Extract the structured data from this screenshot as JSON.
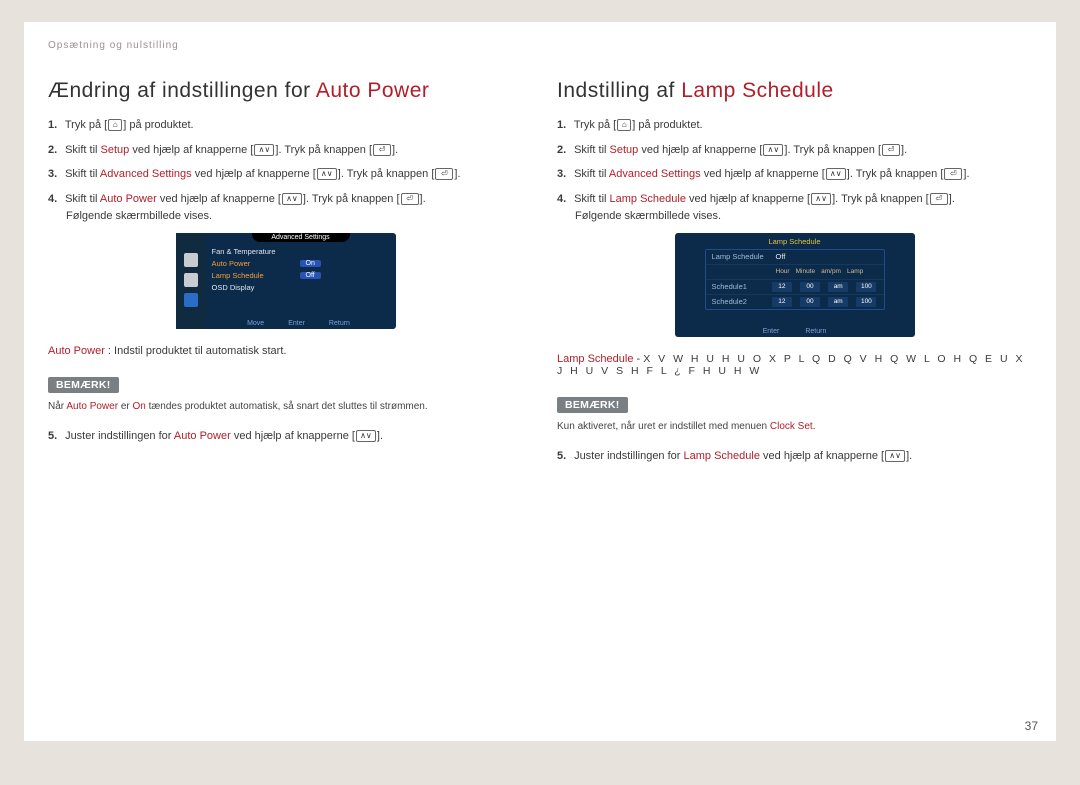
{
  "breadcrumb": "Opsætning og nulstilling",
  "pageNumber": "37",
  "noteLabel": "BEMÆRK!",
  "icons": {
    "home": "⌂",
    "updown": "∧∨",
    "enter": "⏎"
  },
  "left": {
    "titlePlain": "Ændring af indstillingen for ",
    "titleAccent": "Auto Power",
    "steps": {
      "s1": {
        "n": "1.",
        "a": "Tryk på [",
        "b": "] på produktet."
      },
      "s2": {
        "n": "2.",
        "a": "Skift til ",
        "hl": "Setup",
        "b": " ved hjælp af knapperne [",
        "c": "]. Tryk på knappen [",
        "d": "]."
      },
      "s3": {
        "n": "3.",
        "a": "Skift til ",
        "hl": "Advanced Settings",
        "b": " ved hjælp af knapperne [",
        "c": "]. Tryk på knappen [",
        "d": "]."
      },
      "s4": {
        "n": "4.",
        "a": "Skift til ",
        "hl": "Auto Power",
        "b": " ved hjælp af knapperne [",
        "c": "]. Tryk på knappen [",
        "d": "].",
        "sub": "Følgende skærmbillede vises."
      },
      "s5": {
        "n": "5.",
        "a": "Juster indstillingen for ",
        "hl": "Auto Power",
        "b": " ved hjælp af knapperne [",
        "c": "]."
      }
    },
    "osd": {
      "header": "Advanced Settings",
      "rows": {
        "r1": "Fan & Temperature",
        "r2": "Auto Power",
        "r2val": "On",
        "r3": "Lamp Schedule",
        "r3val": "Off",
        "r4": "OSD Display"
      },
      "foot": {
        "a": "Move",
        "b": "Enter",
        "c": "Return"
      }
    },
    "desc": {
      "hl": "Auto Power",
      "sep": " : ",
      "txt": "Indstil produktet til automatisk start."
    },
    "note": {
      "a": "Når ",
      "hl1": "Auto Power",
      "b": " er ",
      "hl2": "On",
      "c": " tændes produktet automatisk, så snart det sluttes til strømmen."
    }
  },
  "right": {
    "titlePlain": "Indstilling af ",
    "titleAccent": "Lamp Schedule",
    "steps": {
      "s1": {
        "n": "1.",
        "a": "Tryk på [",
        "b": "] på produktet."
      },
      "s2": {
        "n": "2.",
        "a": "Skift til ",
        "hl": "Setup",
        "b": " ved hjælp af knapperne [",
        "c": "]. Tryk på knappen [",
        "d": "]."
      },
      "s3": {
        "n": "3.",
        "a": "Skift til ",
        "hl": "Advanced Settings",
        "b": " ved hjælp af knapperne [",
        "c": "]. Tryk på knappen [",
        "d": "]."
      },
      "s4": {
        "n": "4.",
        "a": "Skift til ",
        "hl": "Lamp Schedule",
        "b": " ved hjælp af knapperne [",
        "c": "]. Tryk på knappen [",
        "d": "].",
        "sub": "Følgende skærmbillede vises."
      },
      "s5": {
        "n": "5.",
        "a": "Juster indstillingen for ",
        "hl": "Lamp Schedule",
        "b": " ved hjælp af knapperne [",
        "c": "]."
      }
    },
    "osd": {
      "header": "Lamp Schedule",
      "row1": {
        "lab": "Lamp Schedule",
        "val": "Off"
      },
      "cols": {
        "c1": "Hour",
        "c2": "Minute",
        "c3": "am/pm",
        "c4": "Lamp"
      },
      "rowA": {
        "lab": "Schedule1",
        "v1": "12",
        "v2": "00",
        "v3": "am",
        "v4": "100"
      },
      "rowB": {
        "lab": "Schedule2",
        "v1": "12",
        "v2": "00",
        "v3": "am",
        "v4": "100"
      },
      "foot": {
        "a": "Enter",
        "b": "Return"
      }
    },
    "desc": {
      "hl": "Lamp Schedule",
      "sep": "   - ",
      "garbled": "X V W H U H U   O X P L Q D Q V H Q   W L O   H Q   E U X J H U V S H F L ¿ F H U H W"
    },
    "note": {
      "a": "Kun aktiveret, når uret er indstillet med menuen ",
      "hl": "Clock Set",
      "b": "."
    }
  }
}
